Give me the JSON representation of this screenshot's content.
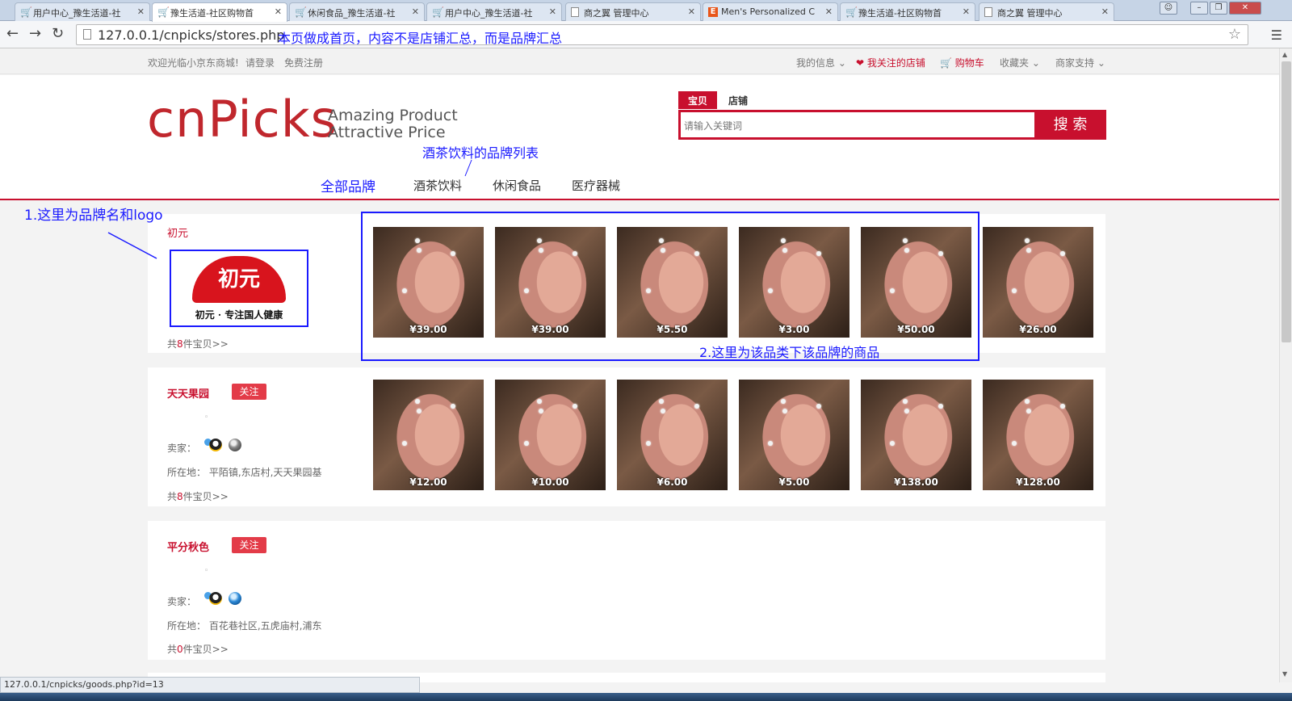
{
  "browser": {
    "tabs": [
      {
        "title": "用户中心_豫生活道-社",
        "icon": "cart-icon",
        "active": false
      },
      {
        "title": "豫生活道-社区购物首",
        "icon": "cart-icon",
        "active": true
      },
      {
        "title": "休闲食品_豫生活道-社",
        "icon": "cart-icon",
        "active": false
      },
      {
        "title": "用户中心_豫生活道-社",
        "icon": "cart-icon",
        "active": false
      },
      {
        "title": "商之翼 管理中心",
        "icon": "page-icon",
        "active": false
      },
      {
        "title": "Men's Personalized C",
        "icon": "etsy-icon",
        "active": false
      },
      {
        "title": "豫生活道-社区购物首",
        "icon": "cart-icon",
        "active": false
      },
      {
        "title": "商之翼 管理中心",
        "icon": "page-icon",
        "active": false
      }
    ],
    "url": "127.0.0.1/cnpicks/stores.php",
    "status_url": "127.0.0.1/cnpicks/goods.php?id=13"
  },
  "annotations": {
    "url_note": "本页做成首页，内容不是店铺汇总，而是品牌汇总",
    "category_note": "酒茶饮料的品牌列表",
    "brand_note": "1.这里为品牌名和logo",
    "goods_note": "2.这里为该品类下该品牌的商品"
  },
  "topbar": {
    "welcome": "欢迎光临小京东商城!",
    "login": "请登录",
    "register": "免费注册",
    "my_info": "我的信息",
    "followed_stores": "我关注的店铺",
    "cart": "购物车",
    "favorites": "收藏夹",
    "merchant_support": "商家支持"
  },
  "header": {
    "logo": "cnPicks",
    "slogan_line1": "Amazing Product",
    "slogan_line2": "Attractive Price",
    "search_tabs": [
      "宝贝",
      "店铺"
    ],
    "search_placeholder": "请输入关键词",
    "search_button": "搜 索",
    "categories": [
      "全部品牌",
      "酒茶饮料",
      "休闲食品",
      "医疗器械"
    ]
  },
  "labels": {
    "follow": "关注",
    "seller": "卖家：",
    "location": "所在地：",
    "dot": "◦"
  },
  "brands": [
    {
      "name": "初元",
      "logo_mark": "初元",
      "logo_caption": "初元 · 专注国人健康",
      "count_prefix": "共",
      "count": "8",
      "count_suffix": "件宝贝>>",
      "prices": [
        "¥39.00",
        "¥39.00",
        "¥5.50",
        "¥3.00",
        "¥50.00",
        "¥26.00"
      ]
    },
    {
      "name": "天天果园",
      "location": "平陌镇,东店村,天天果园基",
      "count_prefix": "共",
      "count": "8",
      "count_suffix": "件宝贝>>",
      "prices": [
        "¥12.00",
        "¥10.00",
        "¥6.00",
        "¥5.00",
        "¥138.00",
        "¥128.00"
      ]
    },
    {
      "name": "平分秋色",
      "location": "百花巷社区,五虎庙村,浦东",
      "count_prefix": "共",
      "count": "0",
      "count_suffix": "件宝贝>>",
      "prices": []
    }
  ],
  "colors": {
    "brand_red": "#c8102e",
    "annotation_blue": "#1a1aff"
  }
}
